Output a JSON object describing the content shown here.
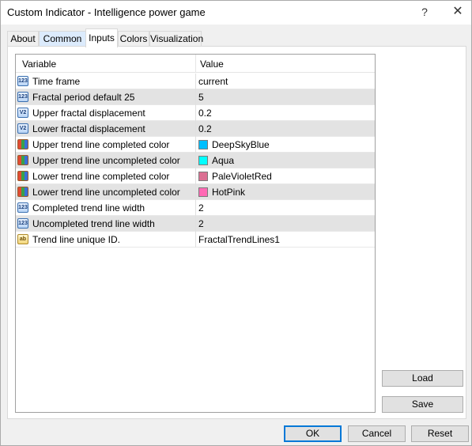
{
  "window": {
    "title": "Custom Indicator - Intelligence power game",
    "help_glyph": "?",
    "close_glyph": "✕"
  },
  "tabs": [
    {
      "label": "About"
    },
    {
      "label": "Common"
    },
    {
      "label": "Inputs"
    },
    {
      "label": "Colors"
    },
    {
      "label": "Visualization"
    }
  ],
  "active_tab": "Inputs",
  "grid": {
    "headers": {
      "variable": "Variable",
      "value": "Value"
    },
    "rows": [
      {
        "icon": "123",
        "variable": "Time frame",
        "value": "current"
      },
      {
        "icon": "123",
        "variable": "Fractal period default 25",
        "value": "5"
      },
      {
        "icon": "V2",
        "variable": "Upper fractal displacement",
        "value": "0.2"
      },
      {
        "icon": "V2",
        "variable": "Lower fractal displacement",
        "value": "0.2"
      },
      {
        "icon": "color",
        "variable": "Upper trend line completed color",
        "value": "DeepSkyBlue",
        "swatch": "#00bfff"
      },
      {
        "icon": "color",
        "variable": "Upper trend line uncompleted color",
        "value": "Aqua",
        "swatch": "#00ffff"
      },
      {
        "icon": "color",
        "variable": "Lower trend line completed color",
        "value": "PaleVioletRed",
        "swatch": "#db7093"
      },
      {
        "icon": "color",
        "variable": "Lower trend line uncompleted color",
        "value": "HotPink",
        "swatch": "#ff69b4"
      },
      {
        "icon": "123",
        "variable": "Completed trend line width",
        "value": "2"
      },
      {
        "icon": "123",
        "variable": "Uncompleted trend line width",
        "value": "2"
      },
      {
        "icon": "ab",
        "variable": "Trend line unique ID.",
        "value": "FractalTrendLines1"
      }
    ]
  },
  "side_buttons": {
    "load": "Load",
    "save": "Save"
  },
  "footer_buttons": {
    "ok": "OK",
    "cancel": "Cancel",
    "reset": "Reset"
  }
}
